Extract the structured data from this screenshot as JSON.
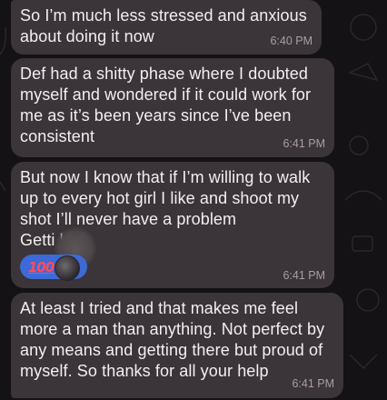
{
  "messages": [
    {
      "text": "So I’m much less stressed and anxious\nabout doing it now",
      "time": "6:40 PM"
    },
    {
      "text": "Def had a shitty phase where I doubted\nmyself and wondered if it could work for\nme as it’s been years since I’ve been\nconsistent",
      "time": "6:41 PM"
    },
    {
      "text": "But now I know that if I’m willing to walk\nup to every hot girl I like and shoot my\nshot I’ll never have a problem\nGetti    laid",
      "time": "6:41 PM",
      "reaction": {
        "emoji": "100",
        "color": "#3d6ad6"
      }
    },
    {
      "text": "At least I tried and that makes me feel\nmore a man than anything. Not perfect by\nany means and getting there but proud of\nmyself. So thanks for all your help",
      "time": "6:41 PM"
    }
  ],
  "colors": {
    "background": "#141214",
    "bubble": "#3b3438",
    "text": "#f2eff1",
    "timestamp": "#a89fa5"
  }
}
